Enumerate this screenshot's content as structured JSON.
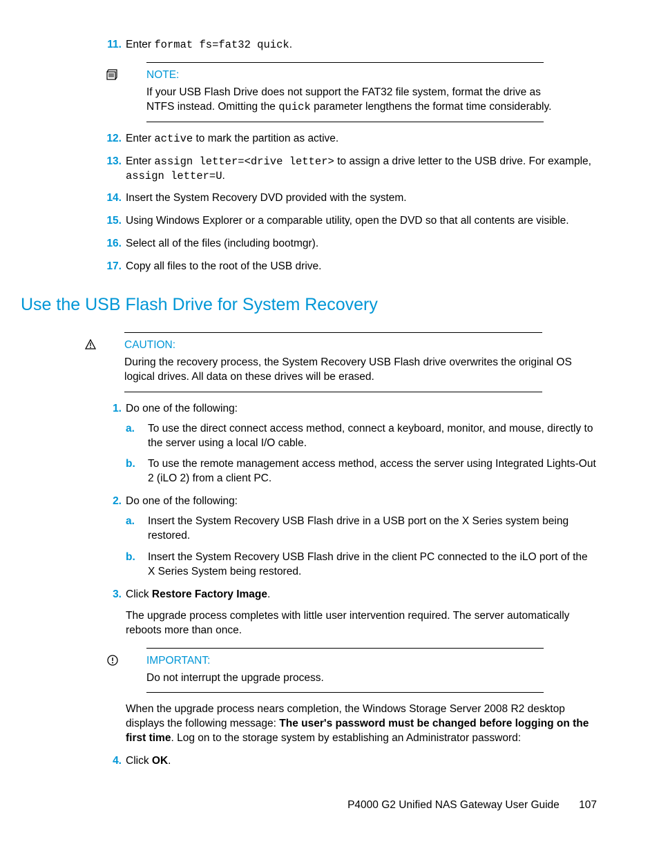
{
  "steps_top": {
    "s11": {
      "num": "11.",
      "prefix": "Enter ",
      "code": "format fs=fat32 quick",
      "suffix": "."
    },
    "note": {
      "head": "NOTE:",
      "body_pre": "If your USB Flash Drive does not support the FAT32 file system, format the drive as NTFS instead. Omitting the ",
      "body_code": "quick",
      "body_post": " parameter lengthens the format time considerably."
    },
    "s12": {
      "num": "12.",
      "prefix": "Enter ",
      "code": "active",
      "suffix": " to mark the partition as active."
    },
    "s13": {
      "num": "13.",
      "prefix": "Enter ",
      "code1": "assign letter=<drive letter>",
      "mid": " to assign a drive letter to the USB drive. For example, ",
      "code2": "assign letter=U",
      "suffix": "."
    },
    "s14": {
      "num": "14.",
      "text": "Insert the System Recovery DVD provided with the system."
    },
    "s15": {
      "num": "15.",
      "text": "Using Windows Explorer or a comparable utility, open the DVD so that all contents are visible."
    },
    "s16": {
      "num": "16.",
      "text": "Select all of the files (including bootmgr)."
    },
    "s17": {
      "num": "17.",
      "text": "Copy all files to the root of the USB drive."
    }
  },
  "heading": "Use the USB Flash Drive for System Recovery",
  "caution": {
    "head": "CAUTION:",
    "body": "During the recovery process, the System Recovery USB Flash drive overwrites the original OS logical drives. All data on these drives will be erased."
  },
  "steps_bottom": {
    "s1": {
      "num": "1.",
      "text": "Do one of the following:",
      "a": {
        "letter": "a.",
        "text": "To use the direct connect access method, connect a keyboard, monitor, and mouse, directly to the server using a local I/O cable."
      },
      "b": {
        "letter": "b.",
        "text": "To use the remote management access method, access the server using Integrated Lights-Out 2 (iLO 2) from a client PC."
      }
    },
    "s2": {
      "num": "2.",
      "text": "Do one of the following:",
      "a": {
        "letter": "a.",
        "text": "Insert the System Recovery USB Flash drive in a USB port on the X Series system being restored."
      },
      "b": {
        "letter": "b.",
        "text": "Insert the System Recovery USB Flash drive in the client PC connected to the iLO port of the X Series System being restored."
      }
    },
    "s3": {
      "num": "3.",
      "prefix": "Click ",
      "bold": "Restore Factory Image",
      "suffix": ".",
      "para": "The upgrade process completes with little user intervention required. The server automatically reboots more than once."
    },
    "important": {
      "head": "IMPORTANT:",
      "body": "Do not interrupt the upgrade process."
    },
    "after_important": {
      "pre": "When the upgrade process nears completion, the Windows Storage Server 2008 R2 desktop displays the following message: ",
      "bold": "The user's password must be changed before logging on the first time",
      "post": ". Log on to the storage system by establishing an Administrator password:"
    },
    "s4": {
      "num": "4.",
      "prefix": "Click ",
      "bold": "OK",
      "suffix": "."
    }
  },
  "footer": {
    "title": "P4000 G2 Unified NAS Gateway User Guide",
    "page": "107"
  }
}
